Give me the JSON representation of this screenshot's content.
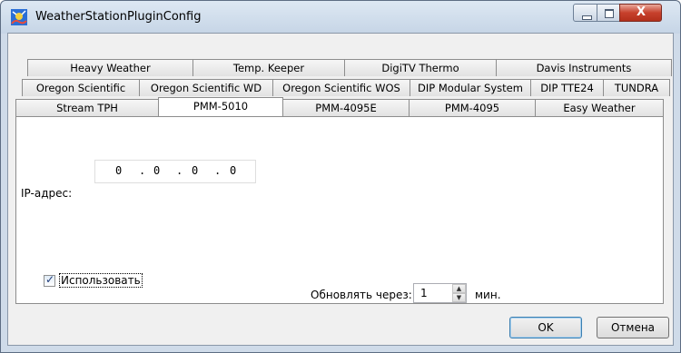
{
  "window": {
    "title": "WeatherStationPluginConfig",
    "close_glyph": "X"
  },
  "tabs": {
    "row1": [
      "Heavy Weather",
      "Temp. Keeper",
      "DigiTV Thermo",
      "Davis Instruments"
    ],
    "row2": [
      "Oregon Scientific",
      "Oregon Scientific WD",
      "Oregon Scientific WOS",
      "DIP Modular System",
      "DIP TTE24",
      "TUNDRA"
    ],
    "row3": [
      "Stream TPH",
      "PMM-5010",
      "PMM-4095E",
      "PMM-4095",
      "Easy Weather"
    ],
    "active": "PMM-5010"
  },
  "panel": {
    "ip_label": "IP-адрес:",
    "ip_segments": [
      "0",
      ".",
      "0",
      ".",
      "0",
      ".",
      "0"
    ],
    "use_label": "Использовать",
    "use_checked": true,
    "refresh_label": "Обновлять через:",
    "refresh_value": "1",
    "refresh_unit": "мин."
  },
  "buttons": {
    "ok": "OK",
    "cancel": "Отмена"
  },
  "icons": {
    "app": "weather-station-icon",
    "minimize": "minimize-icon",
    "maximize": "maximize-icon",
    "close": "close-icon"
  }
}
